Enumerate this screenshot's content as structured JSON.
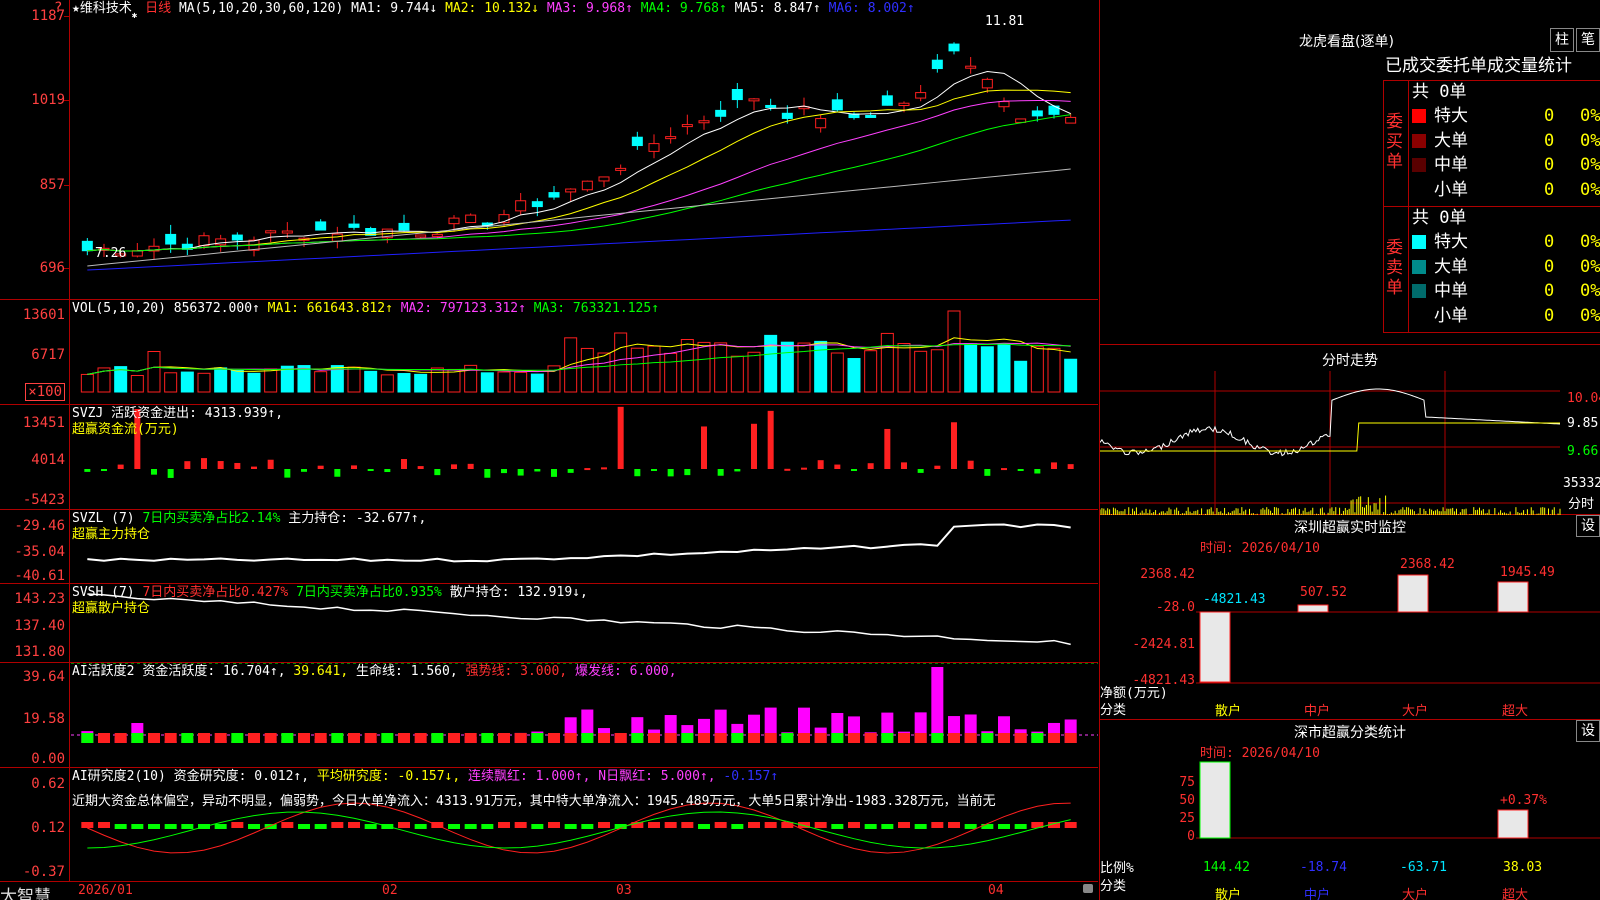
{
  "stock": {
    "name": "维科技术",
    "period": "日线",
    "ma_formula": "MA(5,10,20,30,60,120)",
    "ma1": "MA1: 9.744↓",
    "ma2": "MA2: 10.132↓",
    "ma3": "MA3: 9.968↑",
    "ma4": "MA4: 9.768↑",
    "ma5": "MA5: 8.847↑",
    "ma6": "MA6: 8.002↑",
    "high_mark": "11.81",
    "low_mark": "7.26",
    "price_axis": [
      "1187",
      "1019",
      "857",
      "696"
    ]
  },
  "vol": {
    "formula": "VOL(5,10,20)",
    "vol": "856372.000↑",
    "ma1": "MA1: 661643.812↑",
    "ma2": "MA2: 797123.312↑",
    "ma3": "MA3: 763321.125↑",
    "axis": [
      "13601",
      "6717",
      "×100"
    ]
  },
  "svzj": {
    "name": "SVZJ",
    "line1": "活跃资金进出: 4313.939↑,",
    "line2": "超赢资金流(万元)",
    "axis": [
      "13451",
      "4014",
      "-5423"
    ]
  },
  "svzl": {
    "name": "SVZL (7)",
    "ratio": "7日内买卖净占比2.14%",
    "pos": "主力持仓: -32.677↑,",
    "line2": "超赢主力持仓",
    "axis": [
      "-29.46",
      "-35.04",
      "-40.61"
    ]
  },
  "svsh": {
    "name": "SVSH (7)",
    "ratio1": "7日内买卖净占比0.427%",
    "ratio2": "7日内买卖净占比0.935%",
    "pos": "散户持仓: 132.919↓,",
    "line2": "超赢散户持仓",
    "axis": [
      "143.23",
      "137.40",
      "131.80"
    ]
  },
  "ai1": {
    "name": "AI活跃度2",
    "v1": "资金活跃度: 16.704↑,",
    "v2": "39.641,",
    "v3": "生命线: 1.560,",
    "v4": "强势线: 3.000,",
    "v5": "爆发线: 6.000,",
    "axis": [
      "39.64",
      "19.58",
      "0.00"
    ]
  },
  "ai2": {
    "name": "AI研究度2(10)",
    "v1": "资金研究度: 0.012↑,",
    "v2": "平均研究度: -0.157↓,",
    "v3": "连续飘红: 1.000↑,",
    "v4": "N日飘红: 5.000↑,",
    "v5": "-0.157↑",
    "comment": "近期大资金总体偏空，异动不明显，偏弱势，今日大单净流入：4313.91万元，其中特大单净流入：1945.489万元，大单5日累计净出-1983.328万元，当前无",
    "axis": [
      "0.62",
      "0.12",
      "-0.37"
    ]
  },
  "xaxis": {
    "labels": [
      "2026/01",
      "02",
      "03",
      "04"
    ]
  },
  "brand": "大智慧",
  "lhb": {
    "title": "龙虎看盘(逐单)",
    "btn1": "柱",
    "btn2": "笔",
    "headers": [
      "已成交",
      "委托单",
      "成交量",
      "统计"
    ],
    "buy_label": "委买单",
    "sell_label": "委卖单",
    "buy_total": "共 0单",
    "sell_total": "共 0单",
    "buy_rows": [
      {
        "name": "特大",
        "val": "0",
        "pct": "0%",
        "color": "#ff0000"
      },
      {
        "name": "大单",
        "val": "0",
        "pct": "0%",
        "color": "#8b0000"
      },
      {
        "name": "中单",
        "val": "0",
        "pct": "0%",
        "color": "#5a0000"
      },
      {
        "name": "小单",
        "val": "0",
        "pct": "0%",
        "color": "#000"
      }
    ],
    "sell_rows": [
      {
        "name": "特大",
        "val": "0",
        "pct": "0%",
        "color": "#00ffff"
      },
      {
        "name": "大单",
        "val": "0",
        "pct": "0%",
        "color": "#008b8b"
      },
      {
        "name": "中单",
        "val": "0",
        "pct": "0%",
        "color": "#006b6b"
      },
      {
        "name": "小单",
        "val": "0",
        "pct": "0%",
        "color": "#000"
      }
    ]
  },
  "intraday": {
    "title": "分时走势",
    "axis": [
      "10.04",
      "9.85",
      "9.66"
    ],
    "vol": "35332",
    "vol_label": "分时"
  },
  "sz_monitor": {
    "title": "深圳超赢实时监控",
    "btn": "设",
    "time": "时间: 2026/04/10",
    "axis": [
      "2368.42",
      "-28.0",
      "-2424.81",
      "-4821.43"
    ],
    "values": [
      "-4821.43",
      "507.52",
      "2368.42",
      "1945.49"
    ],
    "cats": [
      "散户",
      "中户",
      "大户",
      "超大"
    ],
    "ylabel1": "净额(万元)",
    "ylabel2": "分类"
  },
  "sz_class": {
    "title": "深市超赢分类统计",
    "btn": "设",
    "time": "时间: 2026/04/10",
    "axis": [
      "75",
      "50",
      "25",
      "0"
    ],
    "values": [
      "144.42",
      "-18.74",
      "-63.71",
      "38.03"
    ],
    "pct_label": "+0.37%",
    "cats": [
      "散户",
      "中户",
      "大户",
      "超大"
    ],
    "ylabel1": "比例%",
    "ylabel2": "分类"
  }
}
